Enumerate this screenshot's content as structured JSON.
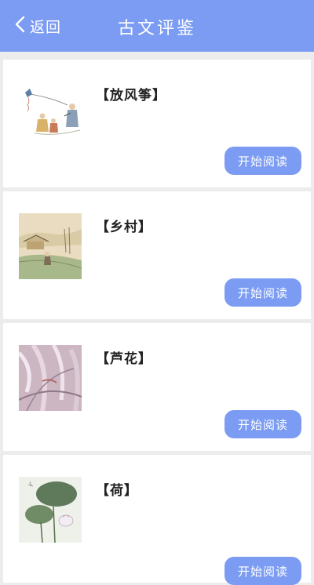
{
  "header": {
    "back_label": "返回",
    "title": "古文评鉴"
  },
  "items": [
    {
      "title": "【放风筝】",
      "button_label": "开始阅读"
    },
    {
      "title": "【乡村】",
      "button_label": "开始阅读"
    },
    {
      "title": "【芦花】",
      "button_label": "开始阅读"
    },
    {
      "title": "【荷】",
      "button_label": "开始阅读"
    }
  ],
  "colors": {
    "accent": "#7b9cf2",
    "background": "#ececec",
    "card": "#ffffff"
  }
}
